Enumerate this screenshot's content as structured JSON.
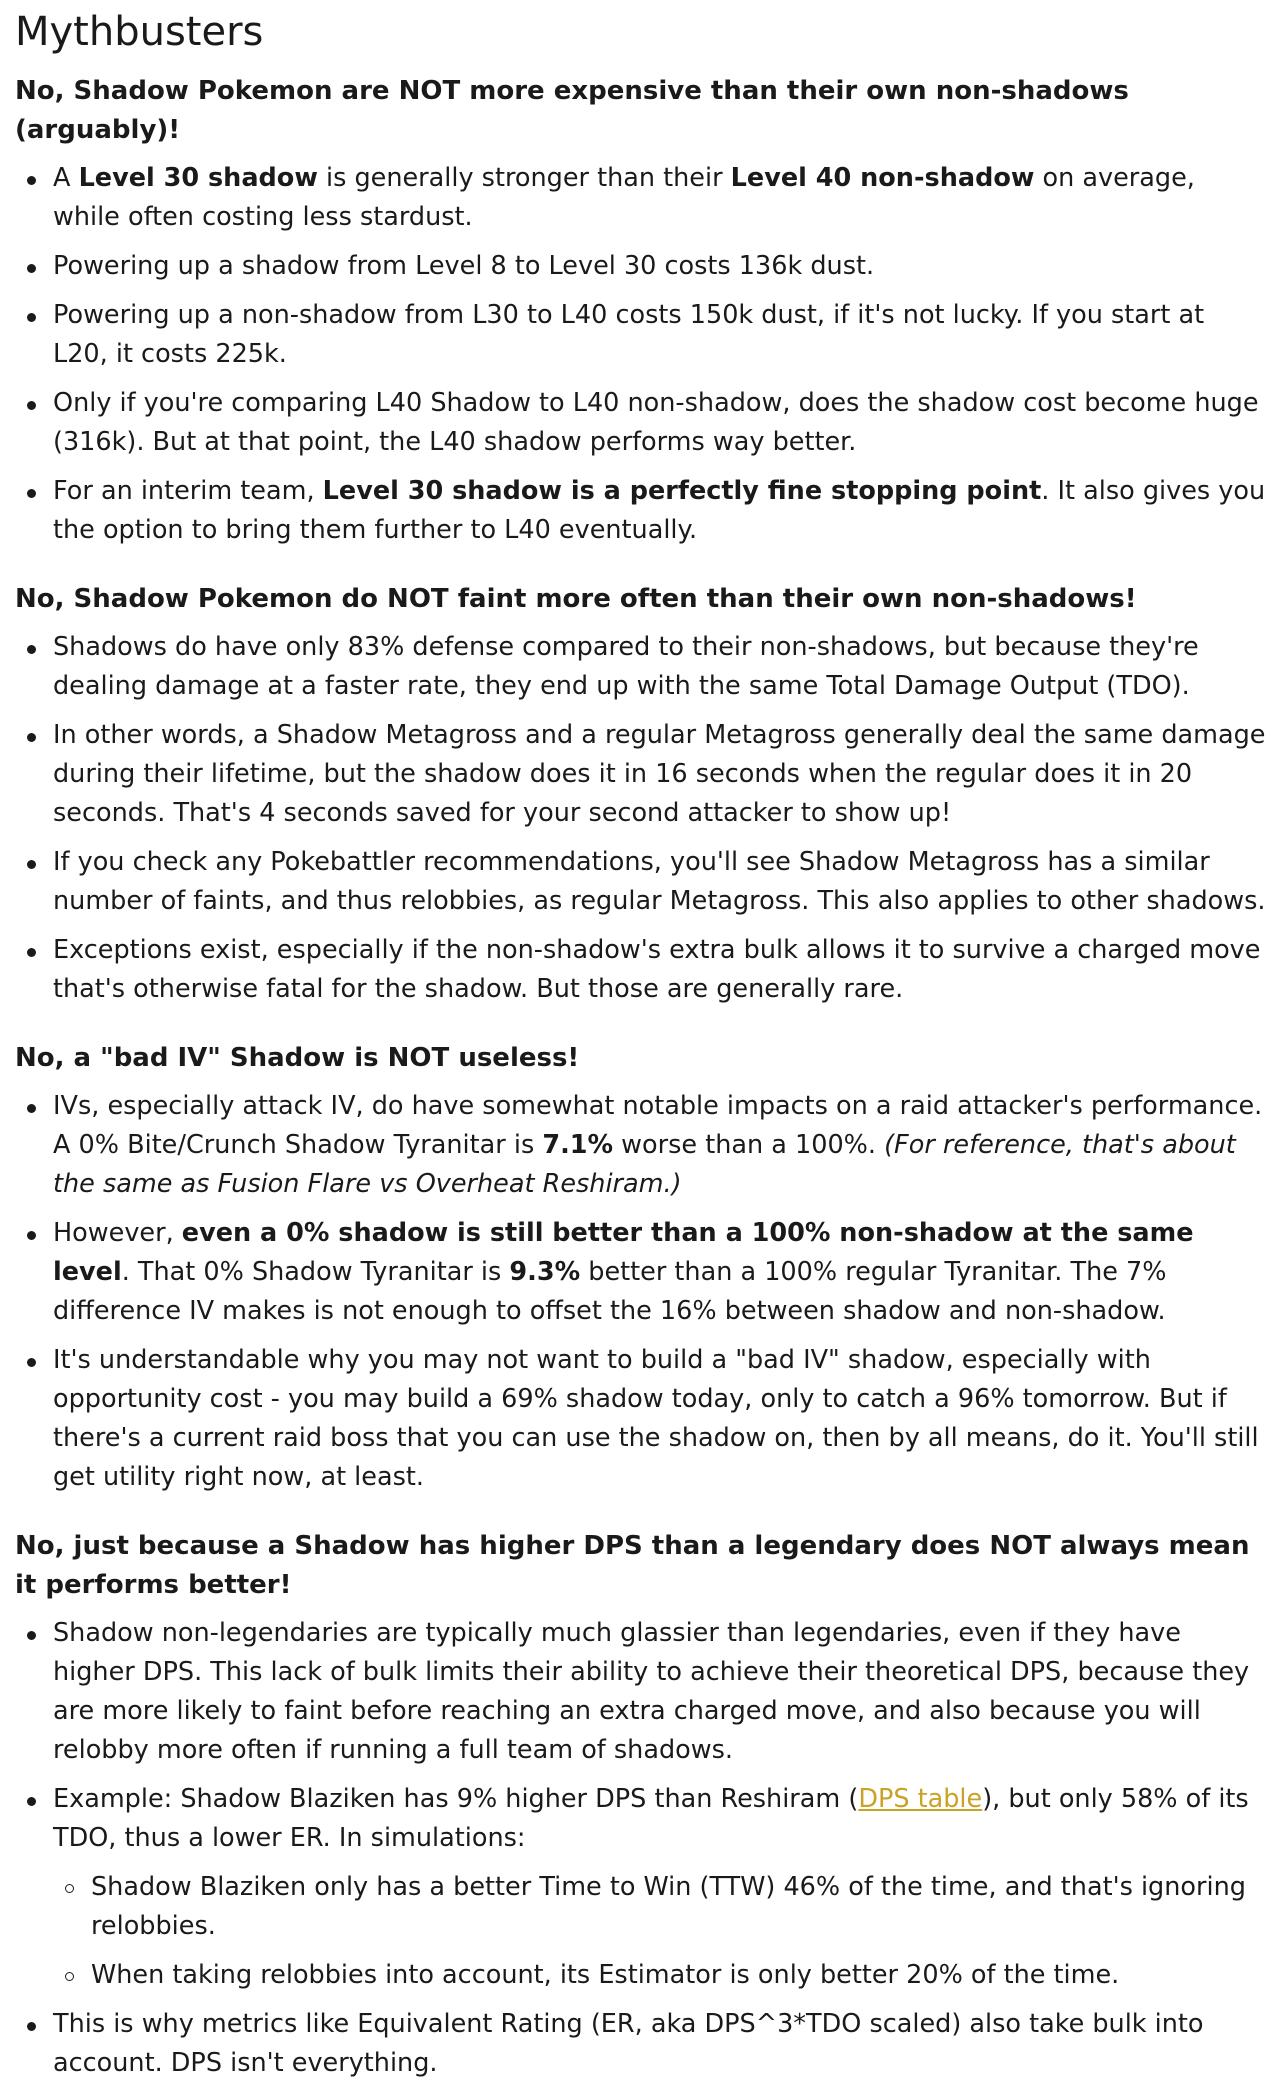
{
  "title": "Mythbusters",
  "sections": [
    {
      "heading": "No, Shadow Pokemon are NOT more expensive than their own non-shadows (arguably)!",
      "items": [
        {
          "a": "A ",
          "b1": "Level 30 shadow",
          "c": " is generally stronger than their ",
          "b2": "Level 40 non-shadow",
          "d": " on average, while often costing less stardust."
        },
        {
          "text": "Powering up a shadow from Level 8 to Level 30 costs 136k dust."
        },
        {
          "text": "Powering up a non-shadow from L30 to L40 costs 150k dust, if it's not lucky. If you start at L20, it costs 225k."
        },
        {
          "text": "Only if you're comparing L40 Shadow to L40 non-shadow, does the shadow cost become huge (316k). But at that point, the L40 shadow performs way better."
        },
        {
          "a": "For an interim team, ",
          "b1": "Level 30 shadow is a perfectly fine stopping point",
          "c": ". It also gives you the option to bring them further to L40 eventually."
        }
      ]
    },
    {
      "heading": "No, Shadow Pokemon do NOT faint more often than their own non-shadows!",
      "items": [
        {
          "text": "Shadows do have only 83% defense compared to their non-shadows, but because they're dealing damage at a faster rate, they end up with the same Total Damage Output (TDO)."
        },
        {
          "text": "In other words, a Shadow Metagross and a regular Metagross generally deal the same damage during their lifetime, but the shadow does it in 16 seconds when the regular does it in 20 seconds. That's 4 seconds saved for your second attacker to show up!"
        },
        {
          "text": "If you check any Pokebattler recommendations, you'll see Shadow Metagross has a similar number of faints, and thus relobbies, as regular Metagross. This also applies to other shadows."
        },
        {
          "text": "Exceptions exist, especially if the non-shadow's extra bulk allows it to survive a charged move that's otherwise fatal for the shadow. But those are generally rare."
        }
      ]
    },
    {
      "heading": "No, a \"bad IV\" Shadow is NOT useless!",
      "items": [
        {
          "a": "IVs, especially attack IV, do have somewhat notable impacts on a raid attacker's performance. A 0% Bite/Crunch Shadow Tyranitar is ",
          "b1": "7.1%",
          "c": " worse than a 100%. ",
          "i1": "(For reference, that's about the same as Fusion Flare vs Overheat Reshiram.)"
        },
        {
          "a": "However, ",
          "b1": "even a 0% shadow is still better than a 100% non-shadow at the same level",
          "c": ". That 0% Shadow Tyranitar is ",
          "b2": "9.3%",
          "d": " better than a 100% regular Tyranitar. The 7% difference IV makes is not enough to offset the 16% between shadow and non-shadow."
        },
        {
          "text": "It's understandable why you may not want to build a \"bad IV\" shadow, especially with opportunity cost - you may build a 69% shadow today, only to catch a 96% tomorrow. But if there's a current raid boss that you can use the shadow on, then by all means, do it. You'll still get utility right now, at least."
        }
      ]
    },
    {
      "heading": "No, just because a Shadow has higher DPS than a legendary does NOT always mean it performs better!",
      "items": [
        {
          "text": "Shadow non-legendaries are typically much glassier than legendaries, even if they have higher DPS. This lack of bulk limits their ability to achieve their theoretical DPS, because they are more likely to faint before reaching an extra charged move, and also because you will relobby more often if running a full team of shadows."
        },
        {
          "a": "Example: Shadow Blaziken has 9% higher DPS than Reshiram (",
          "link": "DPS table",
          "c": "), but only 58% of its TDO, thus a lower ER. In simulations:",
          "sub": [
            "Shadow Blaziken only has a better Time to Win (TTW) 46% of the time, and that's ignoring relobbies.",
            "When taking relobbies into account, its Estimator is only better 20% of the time."
          ]
        },
        {
          "text": "This is why metrics like Equivalent Rating (ER, aka DPS^3*TDO scaled) also take bulk into account. DPS isn't everything."
        }
      ]
    }
  ],
  "colors": {
    "text": "#1a1a1b",
    "link": "#c9a227",
    "background": "#ffffff"
  }
}
